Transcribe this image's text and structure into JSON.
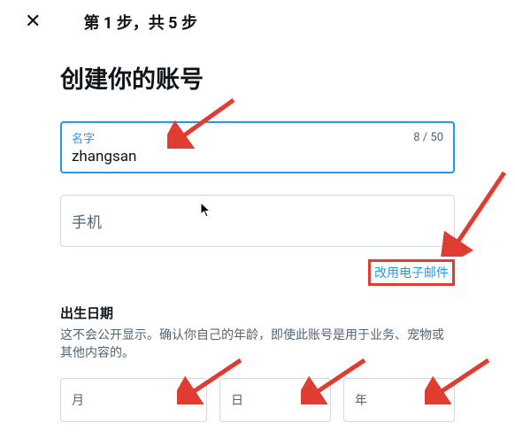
{
  "header": {
    "step_text": "第 1 步，共 5 步"
  },
  "main": {
    "title": "创建你的账号"
  },
  "name_field": {
    "label": "名字",
    "value": "zhangsan",
    "counter": "8 / 50"
  },
  "phone_field": {
    "placeholder": "手机"
  },
  "email_link": {
    "text": "改用电子邮件"
  },
  "dob": {
    "title": "出生日期",
    "desc": "这不会公开显示。确认你自己的年龄，即使此账号是用于业务、宠物或其他内容的。",
    "month": "月",
    "day": "日",
    "year": "年"
  }
}
